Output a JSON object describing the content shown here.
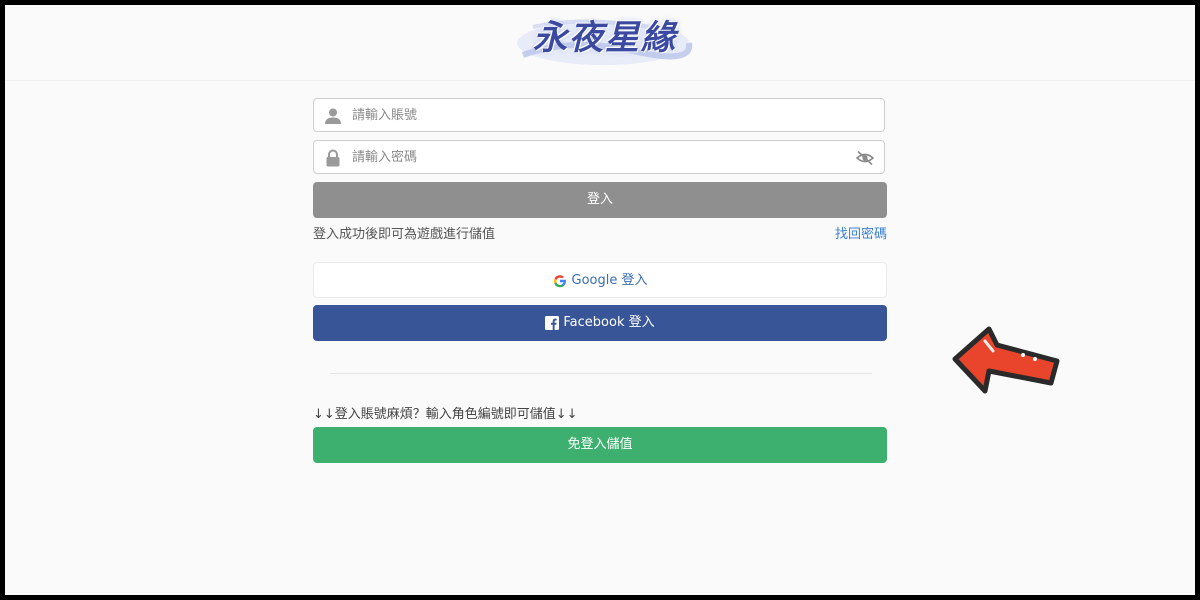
{
  "header": {
    "logo_text": "永夜星緣"
  },
  "login_form": {
    "account_placeholder": "請輸入賬號",
    "password_placeholder": "請輸入密碼",
    "login_button": "登入",
    "note": "登入成功後即可為遊戲進行儲值",
    "forgot_password": "找回密碼"
  },
  "social": {
    "google_label": "Google 登入",
    "facebook_label": "Facebook 登入"
  },
  "guest": {
    "hint": "↓↓登入賬號麻煩？輸入角色編號即可儲值↓↓",
    "pay_button": "免登入儲值"
  },
  "colors": {
    "login_button": "#8f8f8f",
    "facebook": "#385598",
    "pay_button": "#3daf6f",
    "link": "#3a7fd0",
    "arrow": "#e8452c"
  }
}
